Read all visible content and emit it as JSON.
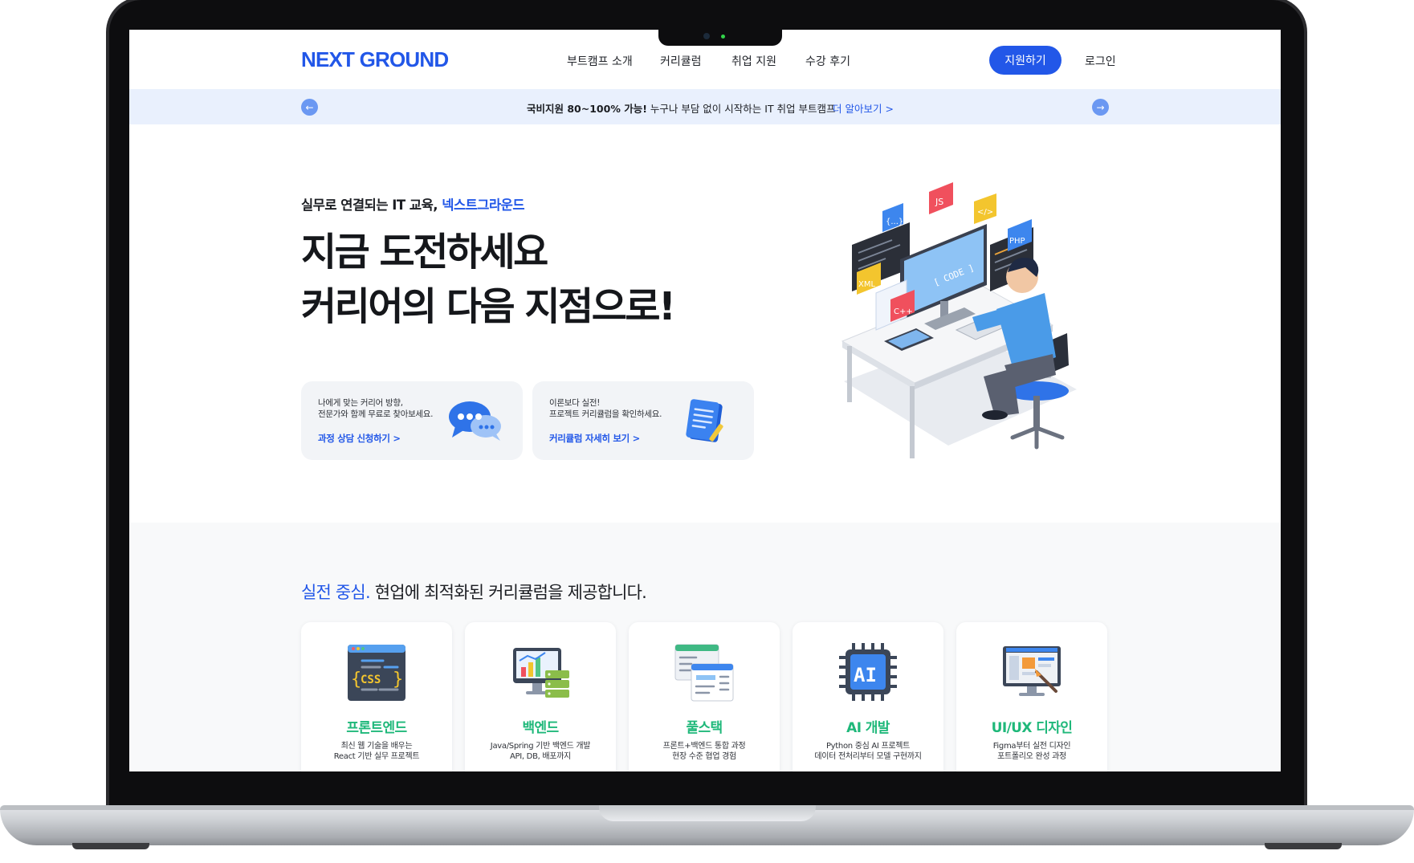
{
  "header": {
    "logo": "NEXT GROUND",
    "nav": [
      "부트캠프 소개",
      "커리큘럼",
      "취업 지원",
      "수강 후기"
    ],
    "apply_button": "지원하기",
    "login": "로그인"
  },
  "banner": {
    "bold_text": "국비지원 80~100% 가능!",
    "text": " 누구나 부담 없이 시작하는 IT 취업 부트캠프",
    "link": "더 알아보기 >",
    "prev_icon": "arrow-left-icon",
    "next_icon": "arrow-right-icon"
  },
  "hero": {
    "subtitle": "실무로 연결되는 IT 교육,",
    "subtitle_accent": "넥스트그라운드",
    "title_line1": "지금 도전하세요",
    "title_line2": "커리어의 다음 지점으로!",
    "cards": [
      {
        "desc_line1": "나에게 맞는 커리어 방향,",
        "desc_line2": "전문가와 함께 무료로 찾아보세요.",
        "link": "과정 상담 신청하기 >",
        "icon": "chat-bubble-icon"
      },
      {
        "desc_line1": "이론보다 실전!",
        "desc_line2": "프로젝트 커리큘럼을 확인하세요.",
        "link": "커리큘럼 자세히 보기 >",
        "icon": "document-icon"
      }
    ],
    "illustration": {
      "badges": [
        "JS",
        "{...}",
        "</>",
        "PHP",
        "XML",
        "C++"
      ],
      "screen_text": "[ CODE ]"
    }
  },
  "curriculum": {
    "title_accent": "실전 중심.",
    "title": " 현업에 최적화된 커리큘럼을 제공합니다.",
    "courses": [
      {
        "name": "프론트엔드",
        "desc_line1": "최신 웹 기술을 배우는",
        "desc_line2": "React 기반 실무 프로젝트",
        "icon": "css-code-window-icon",
        "icon_text": "CSS"
      },
      {
        "name": "백엔드",
        "desc_line1": "Java/Spring 기반 백엔드 개발",
        "desc_line2": "API, DB, 배포까지",
        "icon": "server-monitor-icon"
      },
      {
        "name": "풀스택",
        "desc_line1": "프론트+백엔드 통합 과정",
        "desc_line2": "현장 수준 협업 경험",
        "icon": "browser-windows-icon"
      },
      {
        "name": "AI 개발",
        "desc_line1": "Python 중심 AI 프로젝트",
        "desc_line2": "데이터 전처리부터 모델 구현까지",
        "icon": "ai-chip-icon",
        "icon_text": "AI"
      },
      {
        "name": "UI/UX 디자인",
        "desc_line1": "Figma부터 실전 디자인",
        "desc_line2": "포트폴리오 완성 과정",
        "icon": "design-monitor-icon"
      }
    ]
  },
  "colors": {
    "accent": "#2257e8",
    "course_green": "#1fb87a",
    "banner_bg": "#e9f0fd"
  }
}
